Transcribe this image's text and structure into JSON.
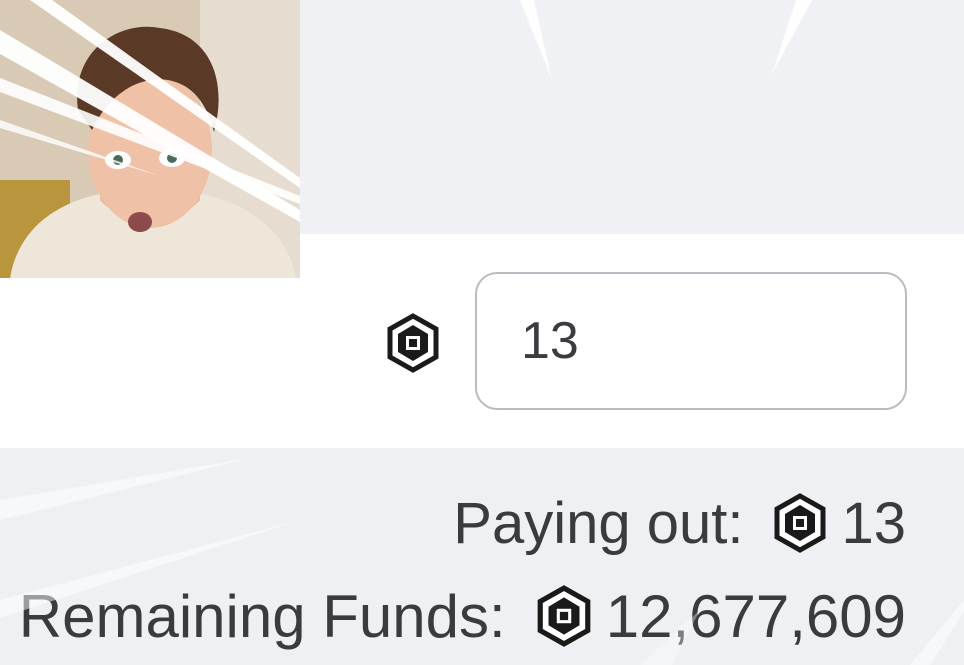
{
  "amount_input": {
    "value": "13",
    "icon": "robux-icon"
  },
  "summary": {
    "paying_out_label": "Paying out:",
    "paying_out_value": "13",
    "remaining_label": "Remaining Funds:",
    "remaining_value": "12,677,609",
    "icon": "robux-icon"
  },
  "overlay": {
    "webcam_icon": "webcam-person",
    "effect": "speed-lines"
  },
  "colors": {
    "panel_bg": "#eef0f3",
    "input_row_bg": "#ffffff",
    "input_border": "#b9bcc2",
    "text": "#393b3f"
  }
}
